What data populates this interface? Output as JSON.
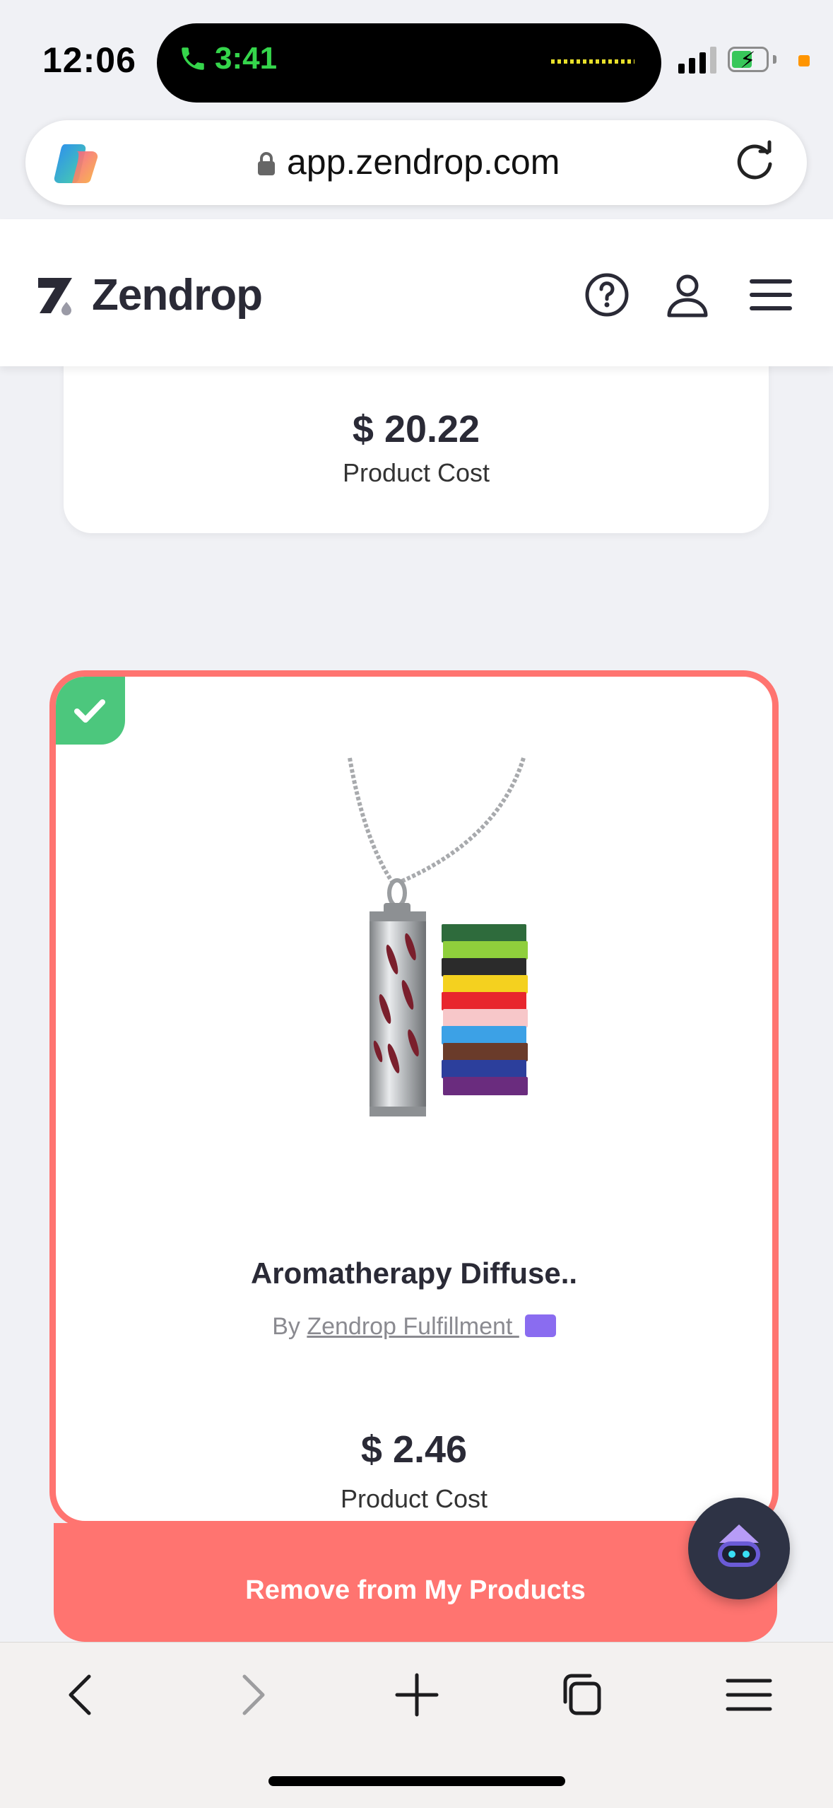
{
  "status_bar": {
    "time": "12:06",
    "call_timer": "3:41"
  },
  "address_bar": {
    "url": "app.zendrop.com"
  },
  "site_header": {
    "brand": "Zendrop"
  },
  "previous_card": {
    "price": "$ 20.22",
    "price_label": "Product Cost"
  },
  "product_card": {
    "selected": true,
    "title": "Aromatherapy Diffuse..",
    "by_prefix": "By",
    "vendor": "Zendrop Fulfillment ",
    "price": "$ 2.46",
    "price_label": "Product Cost",
    "action_label": "Remove from My Products",
    "felt_pad_colors": [
      "#2e6b3c",
      "#8fcf3c",
      "#2b2b2b",
      "#f4d11f",
      "#e8262d",
      "#f7c7c9",
      "#3ca1e6",
      "#6a3b2a",
      "#2c3f9c",
      "#6a2c7e"
    ]
  },
  "colors": {
    "accent": "#ff7470",
    "check": "#4cc77d",
    "text": "#2a2a36"
  },
  "icons": {
    "header": [
      "help-circle-icon",
      "user-icon",
      "hamburger-menu-icon"
    ],
    "toolbar": [
      "back-icon",
      "forward-icon",
      "new-tab-icon",
      "tabs-icon",
      "menu-icon"
    ]
  }
}
